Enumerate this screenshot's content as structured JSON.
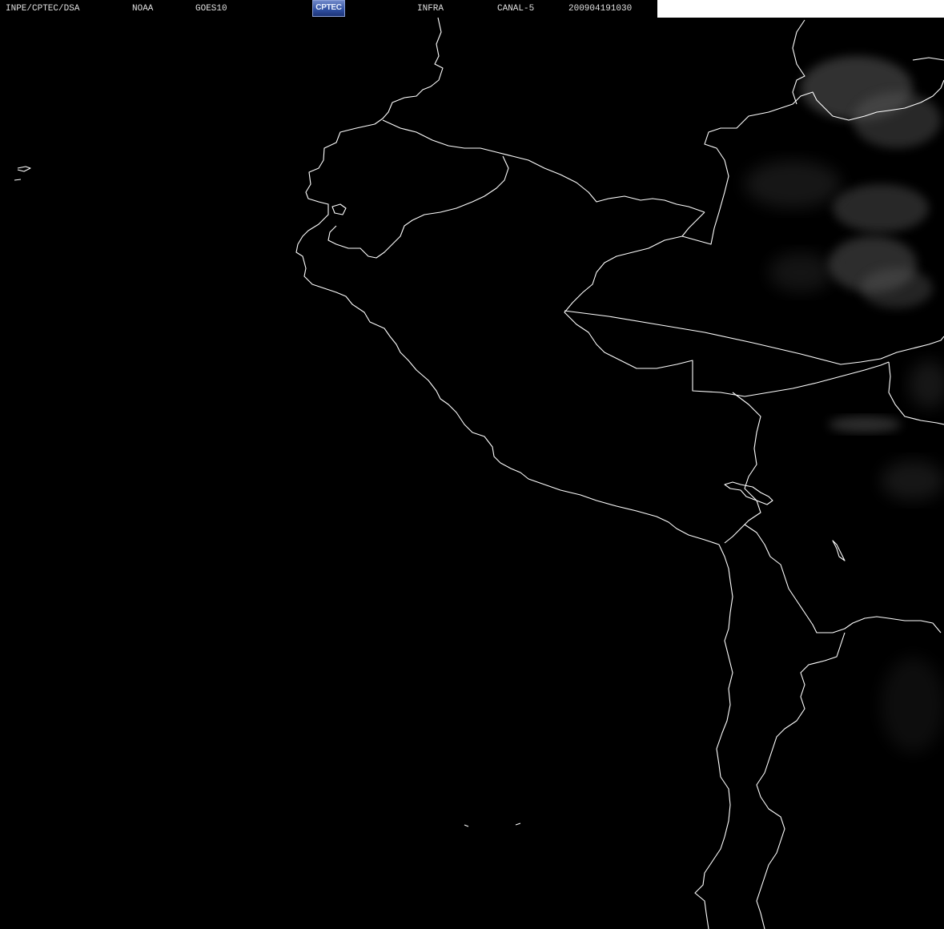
{
  "header": {
    "agency": "INPE/CPTEC/DSA",
    "source": "NOAA",
    "satellite": "GOES10",
    "logo_text": "CPTEC",
    "product": "INFRA",
    "channel": "CANAL-5",
    "timestamp": "200904191030"
  },
  "colors": {
    "background": "#000000",
    "outline": "#ffffff",
    "clouds": "#5a5a5a"
  }
}
